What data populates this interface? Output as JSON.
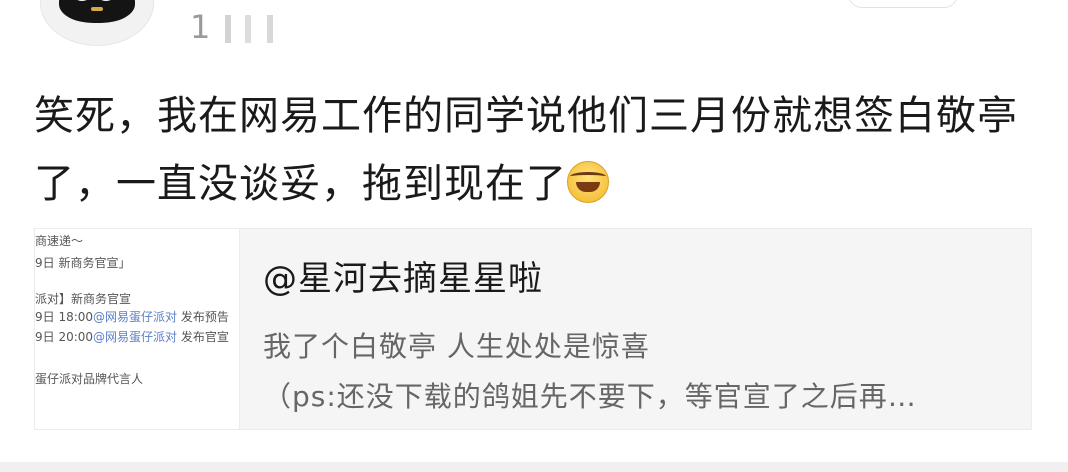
{
  "header": {
    "username": "1",
    "avatar": "black-cartoon-avatar"
  },
  "post": {
    "text": "笑死，我在网易工作的同学说他们三月份就想签白敬亭了，一直没谈妥，拖到现在了",
    "emoji": "laughing-crying-emoji"
  },
  "quote": {
    "author": "@星河去摘星星啦",
    "line1": "我了个白敬亭 人生处处是惊喜",
    "line2": "（ps:还没下载的鸽姐先不要下，等官宣了之后再…",
    "thumbnail": {
      "l1": "商速递～",
      "l2": "9日 新商务官宣」",
      "l3": "派对】新商务官宣",
      "l4a": "9日 18:00",
      "l4b": "@网易蛋仔派对",
      "l4c": " 发布预告",
      "l5a": "9日 20:00",
      "l5b": "@网易蛋仔派对",
      "l5c": " 发布官宣",
      "l6": "蛋仔派对品牌代言人"
    }
  },
  "colors": {
    "text": "#1a1a1a",
    "muted": "#666666",
    "card_bg": "#f5f5f5",
    "link_blue": "#5b7fc9"
  }
}
